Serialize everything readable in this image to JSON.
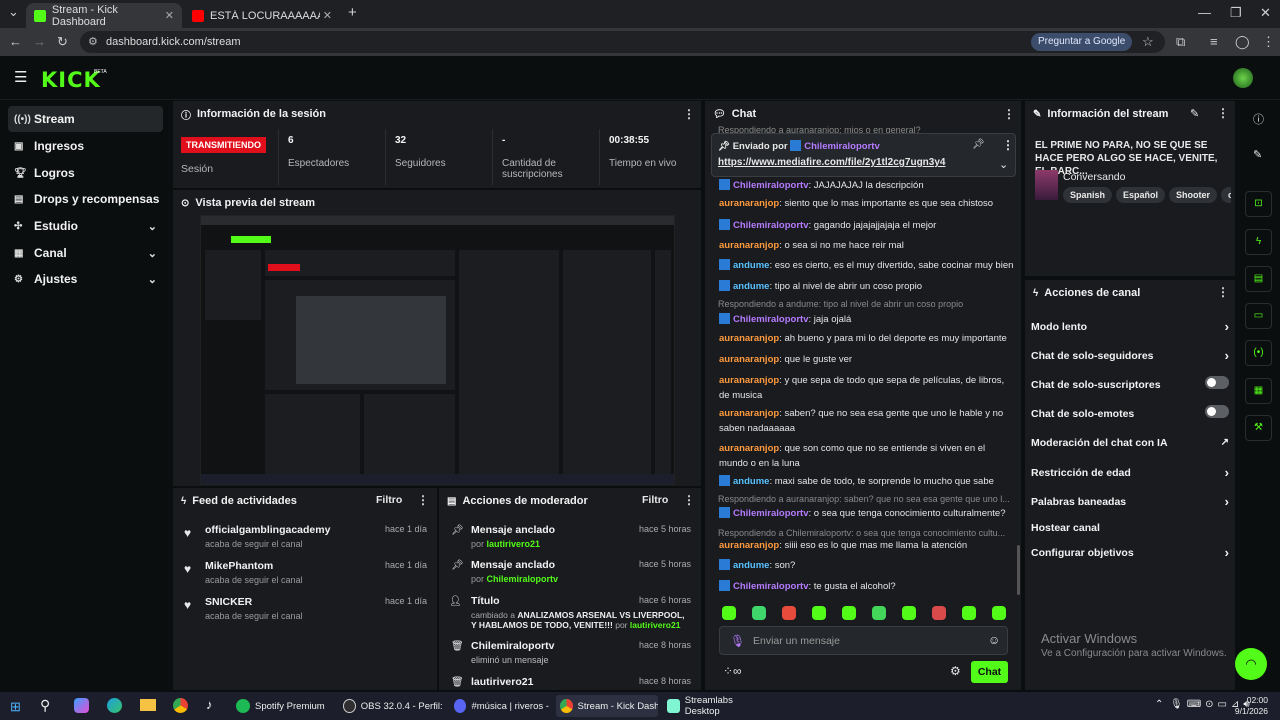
{
  "browser": {
    "tabs": [
      {
        "title": "Stream - Kick Dashboard"
      },
      {
        "title": "ESTÁ LOCURAAAAAAAAAAAAAAA"
      }
    ],
    "new_tab": "+",
    "url": "dashboard.kick.com/stream",
    "ask_google": "Preguntar a Google"
  },
  "brand": {
    "logo": "KICK",
    "beta": "BETA",
    "accent": "#53fc18"
  },
  "sidebar": {
    "items": [
      {
        "label": "Stream",
        "icon": "broadcast-icon"
      },
      {
        "label": "Ingresos",
        "icon": "dollar-icon"
      },
      {
        "label": "Logros",
        "icon": "trophy-icon"
      },
      {
        "label": "Drops y recompensas",
        "icon": "gift-icon"
      },
      {
        "label": "Estudio",
        "icon": "studio-icon"
      },
      {
        "label": "Canal",
        "icon": "channel-icon"
      },
      {
        "label": "Ajustes",
        "icon": "gear-icon"
      }
    ]
  },
  "session": {
    "title": "Información de la sesión",
    "status": "TRANSMITIENDO",
    "status_label": "Sesión",
    "stats": [
      {
        "value": "6",
        "label": "Espectadores"
      },
      {
        "value": "32",
        "label": "Seguidores"
      },
      {
        "value": "-",
        "label": "Cantidad de suscripciones"
      },
      {
        "value": "00:38:55",
        "label": "Tiempo en vivo"
      }
    ]
  },
  "preview": {
    "title": "Vista previa del stream"
  },
  "feed": {
    "title": "Feed de actividades",
    "filter": "Filtro",
    "items": [
      {
        "name": "officialgamblingacademy",
        "sub": "acaba de seguir el canal",
        "time": "hace 1 día"
      },
      {
        "name": "MikePhantom",
        "sub": "acaba de seguir el canal",
        "time": "hace 1 día"
      },
      {
        "name": "SNICKER",
        "sub": "acaba de seguir el canal",
        "time": "hace 1 día"
      }
    ]
  },
  "mod": {
    "title": "Acciones de moderador",
    "filter": "Filtro",
    "items": [
      {
        "title": "Mensaje anclado",
        "by": "por",
        "user": "lautirivero21",
        "time": "hace 5 horas"
      },
      {
        "title": "Mensaje anclado",
        "by": "por",
        "user": "Chilemiraloportv",
        "time": "hace 5 horas"
      },
      {
        "title": "Título",
        "pre": "cambiado a",
        "text": "ANALIZAMOS ARSENAL VS LIVERPOOL, Y HABLAMOS DE TODO, VENITE!!!",
        "by": "por",
        "user": "lautirivero21",
        "time": "hace 6 horas"
      },
      {
        "title": "Chilemiraloportv",
        "sub": "eliminó un mensaje",
        "time": "hace 8 horas"
      },
      {
        "title": "lautirivero21",
        "time": "hace 8 horas"
      }
    ]
  },
  "chat": {
    "title": "Chat",
    "top_reply": "Respondiendo a auranaranjop: mios o en general?",
    "pinned": {
      "label": "Enviado por",
      "user": "Chilemiraloportv",
      "link": "https://www.mediafire.com/file/2y1tl2cg7ugn3y4"
    },
    "messages": [
      {
        "user": "Chilemiraloportv",
        "text": "JAJAJAJAJ la descripción"
      },
      {
        "user": "auranaranjop",
        "text": "siento que lo mas importante es que sea chistoso"
      },
      {
        "user": "Chilemiraloportv",
        "text": "gagando jajajajjajaja el mejor"
      },
      {
        "user": "auranaranjop",
        "text": "o sea si no me hace reir mal"
      },
      {
        "user": "andume",
        "text": "eso es cierto, es el muy divertido, sabe cocinar muy bien"
      },
      {
        "user": "andume",
        "text": "tipo al nivel de abrir un coso propio"
      },
      {
        "reply": "Respondiendo a andume: tipo al nivel de abrir un coso propio"
      },
      {
        "user": "Chilemiraloportv",
        "text": "jaja ojalá"
      },
      {
        "user": "auranaranjop",
        "text": "ah bueno y para mi lo del deporte es muy importante"
      },
      {
        "user": "auranaranjop",
        "text": "que le guste ver"
      },
      {
        "user": "auranaranjop",
        "text": "y que sepa de todo que sepa de películas, de libros, de musica"
      },
      {
        "user": "auranaranjop",
        "text": "saben? que no sea esa gente que uno le hable y no saben nadaaaaaa"
      },
      {
        "user": "auranaranjop",
        "text": "que son como que no se entiende si viven en el mundo o en la luna"
      },
      {
        "user": "andume",
        "text": "maxi sabe de todo, te sorprende lo mucho que sabe"
      },
      {
        "reply": "Respondiendo a auranaranjop: saben? que no sea esa gente que uno l..."
      },
      {
        "user": "Chilemiraloportv",
        "text": "o sea que tenga conocimiento culturalmente?"
      },
      {
        "reply": "Respondiendo a Chilemiraloportv: o sea que tenga conocimiento cultu..."
      },
      {
        "user": "auranaranjop",
        "text": "siiii eso es lo que mas me llama la atención"
      },
      {
        "user": "andume",
        "text": "son?"
      },
      {
        "user": "Chilemiraloportv",
        "text": "te gusta el alcohol?"
      }
    ],
    "placeholder": "Enviar un mensaje",
    "send": "Chat"
  },
  "info": {
    "title": "Información del stream",
    "stream_title": "EL PRIME NO PARA, NO SE QUE SE HACE PERO ALGO SE HACE, VENITE, EL BARC...",
    "category": "Conversando",
    "tags": [
      "Spanish",
      "Español",
      "Shooter",
      "chill"
    ]
  },
  "actions": {
    "title": "Acciones de canal",
    "items": [
      {
        "label": "Modo lento",
        "control": "arrow"
      },
      {
        "label": "Chat de solo-seguidores",
        "control": "arrow"
      },
      {
        "label": "Chat de solo-suscriptores",
        "control": "toggle"
      },
      {
        "label": "Chat de solo-emotes",
        "control": "toggle"
      },
      {
        "label": "Moderación del chat con IA",
        "control": "external"
      },
      {
        "label": "Restricción de edad",
        "control": "arrow"
      },
      {
        "label": "Palabras baneadas",
        "control": "arrow"
      },
      {
        "label": "Hostear canal",
        "control": "none"
      },
      {
        "label": "Configurar objetivos",
        "control": "arrow"
      }
    ]
  },
  "watermark": {
    "line1": "Activar Windows",
    "line2": "Ve a Configuración para activar Windows."
  },
  "taskbar": {
    "apps": [
      {
        "label": "Spotify Premium",
        "color": "#1db954"
      },
      {
        "label": "OBS 32.0.4 - Perfil: ...",
        "color": "#302e31"
      },
      {
        "label": "#música | riveros - ...",
        "color": "#5865f2"
      },
      {
        "label": "Stream - Kick Dash...",
        "color": "#53fc18"
      },
      {
        "label": "Streamlabs Desktop",
        "color": "#80f5d2"
      }
    ],
    "time": "02:00",
    "date": "9/1/2026"
  }
}
